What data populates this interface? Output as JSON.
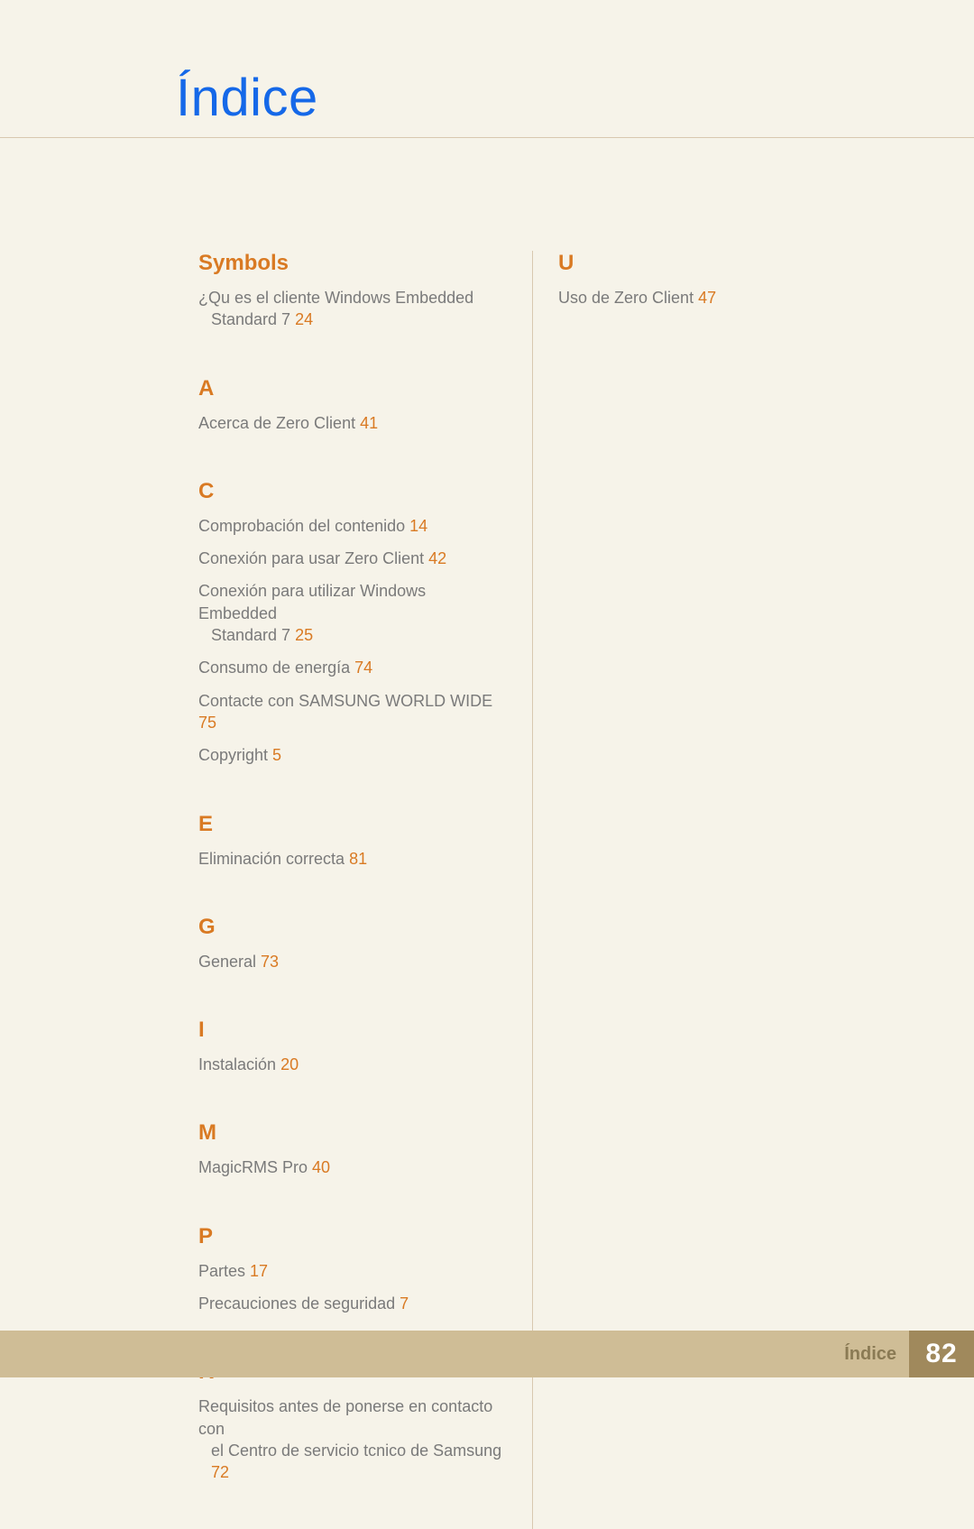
{
  "title": "Índice",
  "footer": {
    "label": "Índice",
    "page": "82"
  },
  "left": [
    {
      "head": "Symbols",
      "entries": [
        {
          "text": "¿Qu es el cliente Windows Embedded",
          "cont": "Standard 7",
          "page": "24"
        }
      ]
    },
    {
      "head": "A",
      "entries": [
        {
          "text": "Acerca de Zero Client",
          "page": "41"
        }
      ]
    },
    {
      "head": "C",
      "entries": [
        {
          "text": "Comprobación del contenido",
          "page": "14"
        },
        {
          "text": "Conexión para usar Zero Client",
          "page": "42"
        },
        {
          "text": "Conexión para utilizar Windows Embedded",
          "cont": "Standard 7",
          "page": "25"
        },
        {
          "text": "Consumo de energía",
          "page": "74"
        },
        {
          "text": "Contacte con SAMSUNG WORLD WIDE",
          "page": "75"
        },
        {
          "text": "Copyright",
          "page": "5"
        }
      ]
    },
    {
      "head": "E",
      "entries": [
        {
          "text": "Eliminación correcta",
          "page": "81"
        }
      ]
    },
    {
      "head": "G",
      "entries": [
        {
          "text": "General",
          "page": "73"
        }
      ]
    },
    {
      "head": "I",
      "entries": [
        {
          "text": "Instalación",
          "page": "20"
        }
      ]
    },
    {
      "head": "M",
      "entries": [
        {
          "text": "MagicRMS Pro",
          "page": "40"
        }
      ]
    },
    {
      "head": "P",
      "entries": [
        {
          "text": "Partes",
          "page": "17"
        },
        {
          "text": "Precauciones de seguridad",
          "page": "7"
        }
      ]
    },
    {
      "head": "R",
      "entries": [
        {
          "text": "Requisitos antes de ponerse en contacto con",
          "cont": "el Centro de servicio tcnico de Samsung",
          "page": "72"
        }
      ]
    }
  ],
  "right": [
    {
      "head": "U",
      "entries": [
        {
          "text": "Uso de Zero Client",
          "page": "47"
        }
      ]
    }
  ]
}
